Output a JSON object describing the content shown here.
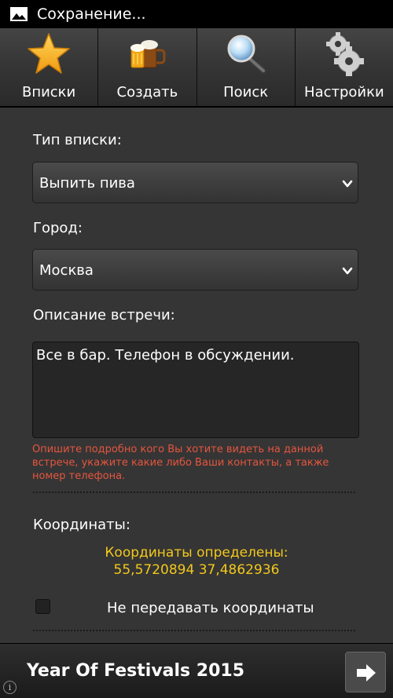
{
  "status_bar": {
    "icon": "image-icon",
    "title": "Сохранение..."
  },
  "tabs": [
    {
      "label": "Вписки",
      "icon": "star-icon"
    },
    {
      "label": "Создать",
      "icon": "beer-mug-icon"
    },
    {
      "label": "Поиск",
      "icon": "magnifier-icon"
    },
    {
      "label": "Настройки",
      "icon": "gears-icon"
    }
  ],
  "form": {
    "type_label": "Тип вписки:",
    "type_value": "Выпить пива",
    "city_label": "Город:",
    "city_value": "Москва",
    "description_label": "Описание встречи:",
    "description_value": "Все в бар. Телефон в обсуждении.",
    "description_hint": "Опишите подробно кого Вы хотите видеть на данной встрече, укажите какие либо Ваши контакты, а также номер телефона.",
    "coords_label": "Координаты:",
    "coords_status": "Координаты определены:",
    "coords_value": "55,5720894 37,4862936",
    "no_coords_label": "Не передавать координаты",
    "no_coords_checked": false
  },
  "ad": {
    "title": "Year Of Festivals 2015",
    "info": "i",
    "icon": "arrow-right-icon"
  },
  "colors": {
    "hint": "#e5553f",
    "coords": "#f2c81c",
    "background": "#353535"
  }
}
